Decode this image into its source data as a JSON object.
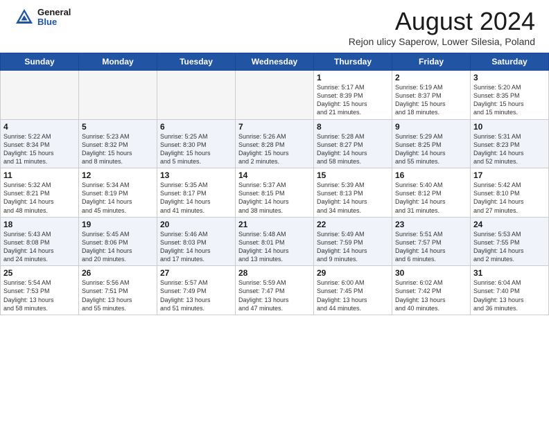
{
  "header": {
    "logo_general": "General",
    "logo_blue": "Blue",
    "title": "August 2024",
    "subtitle": "Rejon ulicy Saperow, Lower Silesia, Poland"
  },
  "weekdays": [
    "Sunday",
    "Monday",
    "Tuesday",
    "Wednesday",
    "Thursday",
    "Friday",
    "Saturday"
  ],
  "weeks": [
    [
      {
        "day": "",
        "info": ""
      },
      {
        "day": "",
        "info": ""
      },
      {
        "day": "",
        "info": ""
      },
      {
        "day": "",
        "info": ""
      },
      {
        "day": "1",
        "info": "Sunrise: 5:17 AM\nSunset: 8:39 PM\nDaylight: 15 hours\nand 21 minutes."
      },
      {
        "day": "2",
        "info": "Sunrise: 5:19 AM\nSunset: 8:37 PM\nDaylight: 15 hours\nand 18 minutes."
      },
      {
        "day": "3",
        "info": "Sunrise: 5:20 AM\nSunset: 8:35 PM\nDaylight: 15 hours\nand 15 minutes."
      }
    ],
    [
      {
        "day": "4",
        "info": "Sunrise: 5:22 AM\nSunset: 8:34 PM\nDaylight: 15 hours\nand 11 minutes."
      },
      {
        "day": "5",
        "info": "Sunrise: 5:23 AM\nSunset: 8:32 PM\nDaylight: 15 hours\nand 8 minutes."
      },
      {
        "day": "6",
        "info": "Sunrise: 5:25 AM\nSunset: 8:30 PM\nDaylight: 15 hours\nand 5 minutes."
      },
      {
        "day": "7",
        "info": "Sunrise: 5:26 AM\nSunset: 8:28 PM\nDaylight: 15 hours\nand 2 minutes."
      },
      {
        "day": "8",
        "info": "Sunrise: 5:28 AM\nSunset: 8:27 PM\nDaylight: 14 hours\nand 58 minutes."
      },
      {
        "day": "9",
        "info": "Sunrise: 5:29 AM\nSunset: 8:25 PM\nDaylight: 14 hours\nand 55 minutes."
      },
      {
        "day": "10",
        "info": "Sunrise: 5:31 AM\nSunset: 8:23 PM\nDaylight: 14 hours\nand 52 minutes."
      }
    ],
    [
      {
        "day": "11",
        "info": "Sunrise: 5:32 AM\nSunset: 8:21 PM\nDaylight: 14 hours\nand 48 minutes."
      },
      {
        "day": "12",
        "info": "Sunrise: 5:34 AM\nSunset: 8:19 PM\nDaylight: 14 hours\nand 45 minutes."
      },
      {
        "day": "13",
        "info": "Sunrise: 5:35 AM\nSunset: 8:17 PM\nDaylight: 14 hours\nand 41 minutes."
      },
      {
        "day": "14",
        "info": "Sunrise: 5:37 AM\nSunset: 8:15 PM\nDaylight: 14 hours\nand 38 minutes."
      },
      {
        "day": "15",
        "info": "Sunrise: 5:39 AM\nSunset: 8:13 PM\nDaylight: 14 hours\nand 34 minutes."
      },
      {
        "day": "16",
        "info": "Sunrise: 5:40 AM\nSunset: 8:12 PM\nDaylight: 14 hours\nand 31 minutes."
      },
      {
        "day": "17",
        "info": "Sunrise: 5:42 AM\nSunset: 8:10 PM\nDaylight: 14 hours\nand 27 minutes."
      }
    ],
    [
      {
        "day": "18",
        "info": "Sunrise: 5:43 AM\nSunset: 8:08 PM\nDaylight: 14 hours\nand 24 minutes."
      },
      {
        "day": "19",
        "info": "Sunrise: 5:45 AM\nSunset: 8:06 PM\nDaylight: 14 hours\nand 20 minutes."
      },
      {
        "day": "20",
        "info": "Sunrise: 5:46 AM\nSunset: 8:03 PM\nDaylight: 14 hours\nand 17 minutes."
      },
      {
        "day": "21",
        "info": "Sunrise: 5:48 AM\nSunset: 8:01 PM\nDaylight: 14 hours\nand 13 minutes."
      },
      {
        "day": "22",
        "info": "Sunrise: 5:49 AM\nSunset: 7:59 PM\nDaylight: 14 hours\nand 9 minutes."
      },
      {
        "day": "23",
        "info": "Sunrise: 5:51 AM\nSunset: 7:57 PM\nDaylight: 14 hours\nand 6 minutes."
      },
      {
        "day": "24",
        "info": "Sunrise: 5:53 AM\nSunset: 7:55 PM\nDaylight: 14 hours\nand 2 minutes."
      }
    ],
    [
      {
        "day": "25",
        "info": "Sunrise: 5:54 AM\nSunset: 7:53 PM\nDaylight: 13 hours\nand 58 minutes."
      },
      {
        "day": "26",
        "info": "Sunrise: 5:56 AM\nSunset: 7:51 PM\nDaylight: 13 hours\nand 55 minutes."
      },
      {
        "day": "27",
        "info": "Sunrise: 5:57 AM\nSunset: 7:49 PM\nDaylight: 13 hours\nand 51 minutes."
      },
      {
        "day": "28",
        "info": "Sunrise: 5:59 AM\nSunset: 7:47 PM\nDaylight: 13 hours\nand 47 minutes."
      },
      {
        "day": "29",
        "info": "Sunrise: 6:00 AM\nSunset: 7:45 PM\nDaylight: 13 hours\nand 44 minutes."
      },
      {
        "day": "30",
        "info": "Sunrise: 6:02 AM\nSunset: 7:42 PM\nDaylight: 13 hours\nand 40 minutes."
      },
      {
        "day": "31",
        "info": "Sunrise: 6:04 AM\nSunset: 7:40 PM\nDaylight: 13 hours\nand 36 minutes."
      }
    ]
  ]
}
